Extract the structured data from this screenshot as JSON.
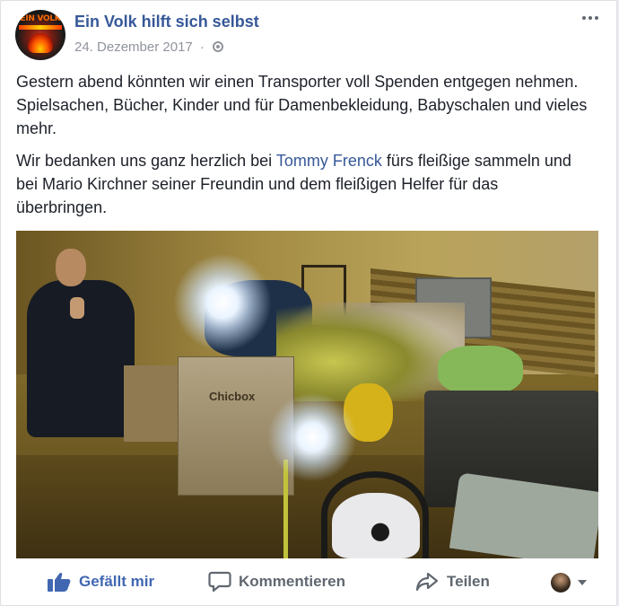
{
  "post": {
    "page_name": "Ein Volk hilft sich selbst",
    "avatar_text": "EIN VOLK",
    "date": "24. Dezember 2017",
    "separator": "·",
    "privacy_icon": "globe-icon",
    "more_icon": "more-horizontal-icon",
    "paragraph1": "Gestern abend könnten wir einen Transporter voll Spenden entgegen nehmen. Spielsachen, Bücher, Kinder und für Damenbekleidung, Babyschalen und vieles mehr.",
    "paragraph2_before": "Wir bedanken uns ganz herzlich bei ",
    "mention": "Tommy Frenck",
    "paragraph2_after": " fürs fleißige sammeln und bei Mario Kirchner seiner Freundin und dem fleißigen Helfer für das überbringen."
  },
  "photo": {
    "box_label": "Chicbox"
  },
  "actions": {
    "like_label": "Gefällt mir",
    "comment_label": "Kommentieren",
    "share_label": "Teilen",
    "like_icon": "thumbs-up-icon",
    "comment_icon": "speech-bubble-icon",
    "share_icon": "share-arrow-icon",
    "reacting_as_icon": "profile-avatar-icon",
    "dropdown_icon": "caret-down-icon"
  },
  "colors": {
    "link": "#365899",
    "like_active": "#4267b2",
    "action_text": "#606770",
    "meta": "#90949c",
    "text": "#1d2129"
  }
}
